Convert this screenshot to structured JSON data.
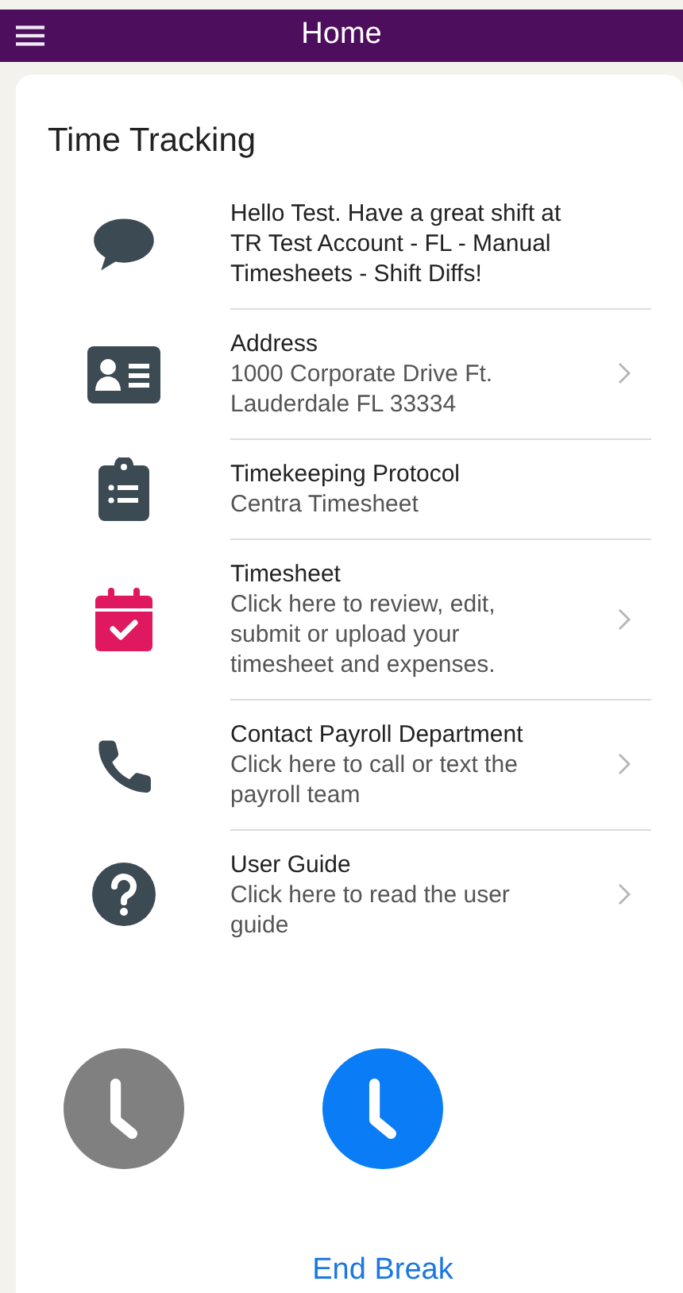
{
  "header": {
    "title": "Home"
  },
  "card": {
    "title": "Time Tracking",
    "items": [
      {
        "kind": "chat",
        "title": "Hello Test. Have a great shift at TR Test Account - FL - Manual Timesheets - Shift Diffs!",
        "chevron": false
      },
      {
        "kind": "id-card",
        "title": "Address",
        "subtitle": "1000 Corporate Drive Ft. Lauderdale FL 33334",
        "chevron": true
      },
      {
        "kind": "clipboard",
        "title": "Timekeeping Protocol",
        "subtitle": "Centra Timesheet",
        "chevron": false
      },
      {
        "kind": "calendar",
        "title": "Timesheet",
        "subtitle": "Click here to review, edit, submit or upload your timesheet and expenses.",
        "chevron": true
      },
      {
        "kind": "phone",
        "title": "Contact Payroll Department",
        "subtitle": "Click here to call or text the payroll team",
        "chevron": true
      },
      {
        "kind": "question",
        "title": "User Guide",
        "subtitle": "Click here to read the user guide",
        "chevron": true
      }
    ],
    "clock_buttons": [
      {
        "enabled": false
      },
      {
        "enabled": true,
        "label": "End Break"
      }
    ]
  }
}
